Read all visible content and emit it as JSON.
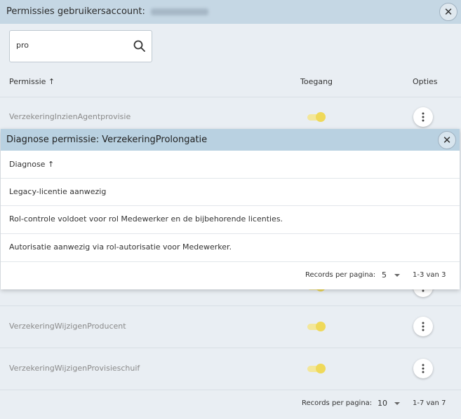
{
  "outer_dialog": {
    "title": "Permissies gebruikersaccount:",
    "search": {
      "value": "pro",
      "placeholder": ""
    },
    "columns": {
      "permission": "Permissie ↑",
      "access": "Toegang",
      "options": "Opties"
    },
    "rows": [
      {
        "name": "VerzekeringInzienAgentprovisie",
        "access_enabled": true
      },
      {
        "name": "VerzekeringWijzigenProducent",
        "access_enabled": true
      },
      {
        "name": "VerzekeringWijzigenProvisieschuif",
        "access_enabled": true
      }
    ],
    "footer": {
      "records_label": "Records per pagina:",
      "page_size": "10",
      "range": "1-7 van 7"
    }
  },
  "inner_dialog": {
    "title": "Diagnose permissie: VerzekeringProlongatie",
    "column": "Diagnose ↑",
    "rows": [
      "Legacy-licentie aanwezig",
      "Rol-controle voldoet voor rol Medewerker en de bijbehorende licenties.",
      "Autorisatie aanwezig via rol-autorisatie voor Medewerker."
    ],
    "footer": {
      "records_label": "Records per pagina:",
      "page_size": "5",
      "range": "1-3 van 3"
    }
  },
  "icons": {
    "close": "close-icon",
    "search": "search-icon",
    "more": "more-vertical-icon",
    "dropdown": "chevron-down-icon"
  },
  "colors": {
    "header_bg": "#c5d7e4",
    "inner_header_bg": "#b9d1e1",
    "toggle_on": "#efd95a"
  }
}
